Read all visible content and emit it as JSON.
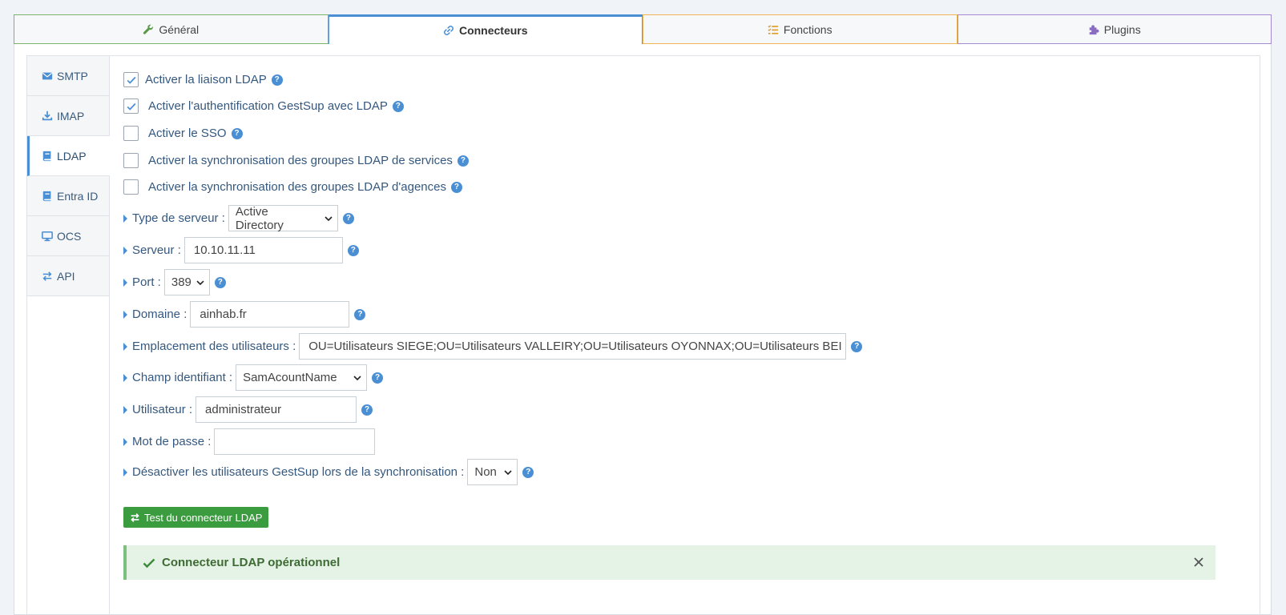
{
  "top_tabs": [
    {
      "label": "Général",
      "icon": "wrench-icon",
      "color": "#5a9a48"
    },
    {
      "label": "Connecteurs",
      "icon": "link-icon",
      "color": "#4a8fd4"
    },
    {
      "label": "Fonctions",
      "icon": "list-icon",
      "color": "#e0a030"
    },
    {
      "label": "Plugins",
      "icon": "puzzle-icon",
      "color": "#8a6cc2"
    }
  ],
  "side_tabs": [
    {
      "label": "SMTP",
      "icon": "envelope-icon"
    },
    {
      "label": "IMAP",
      "icon": "download-icon"
    },
    {
      "label": "LDAP",
      "icon": "book-icon"
    },
    {
      "label": "Entra ID",
      "icon": "book-icon"
    },
    {
      "label": "OCS",
      "icon": "desktop-icon"
    },
    {
      "label": "API",
      "icon": "exchange-icon"
    }
  ],
  "checkboxes": [
    {
      "label": "Activer la liaison LDAP",
      "checked": true
    },
    {
      "label": "Activer l'authentification GestSup avec LDAP",
      "checked": true
    },
    {
      "label": "Activer le SSO",
      "checked": false
    },
    {
      "label": "Activer la synchronisation des groupes LDAP de services",
      "checked": false
    },
    {
      "label": "Activer la synchronisation des groupes LDAP d'agences",
      "checked": false
    }
  ],
  "fields": {
    "server_type": {
      "label": "Type de serveur :",
      "value": "Active Directory"
    },
    "server": {
      "label": "Serveur :",
      "value": "10.10.11.11"
    },
    "port": {
      "label": "Port :",
      "value": "389"
    },
    "domain": {
      "label": "Domaine :",
      "value": "ainhab.fr"
    },
    "users_location": {
      "label": "Emplacement des utilisateurs :",
      "value": "OU=Utilisateurs SIEGE;OU=Utilisateurs VALLEIRY;OU=Utilisateurs OYONNAX;OU=Utilisateurs BEI"
    },
    "id_field": {
      "label": "Champ identifiant :",
      "value": "SamAcountName"
    },
    "user": {
      "label": "Utilisateur :",
      "value": "administrateur"
    },
    "password": {
      "label": "Mot de passe :",
      "value": ""
    },
    "disable_users": {
      "label": "Désactiver les utilisateurs GestSup lors de la synchronisation :",
      "value": "Non"
    }
  },
  "test_button": "Test du connecteur LDAP",
  "alert": {
    "message": "Connecteur LDAP opérationnel"
  },
  "help_glyph": "?"
}
